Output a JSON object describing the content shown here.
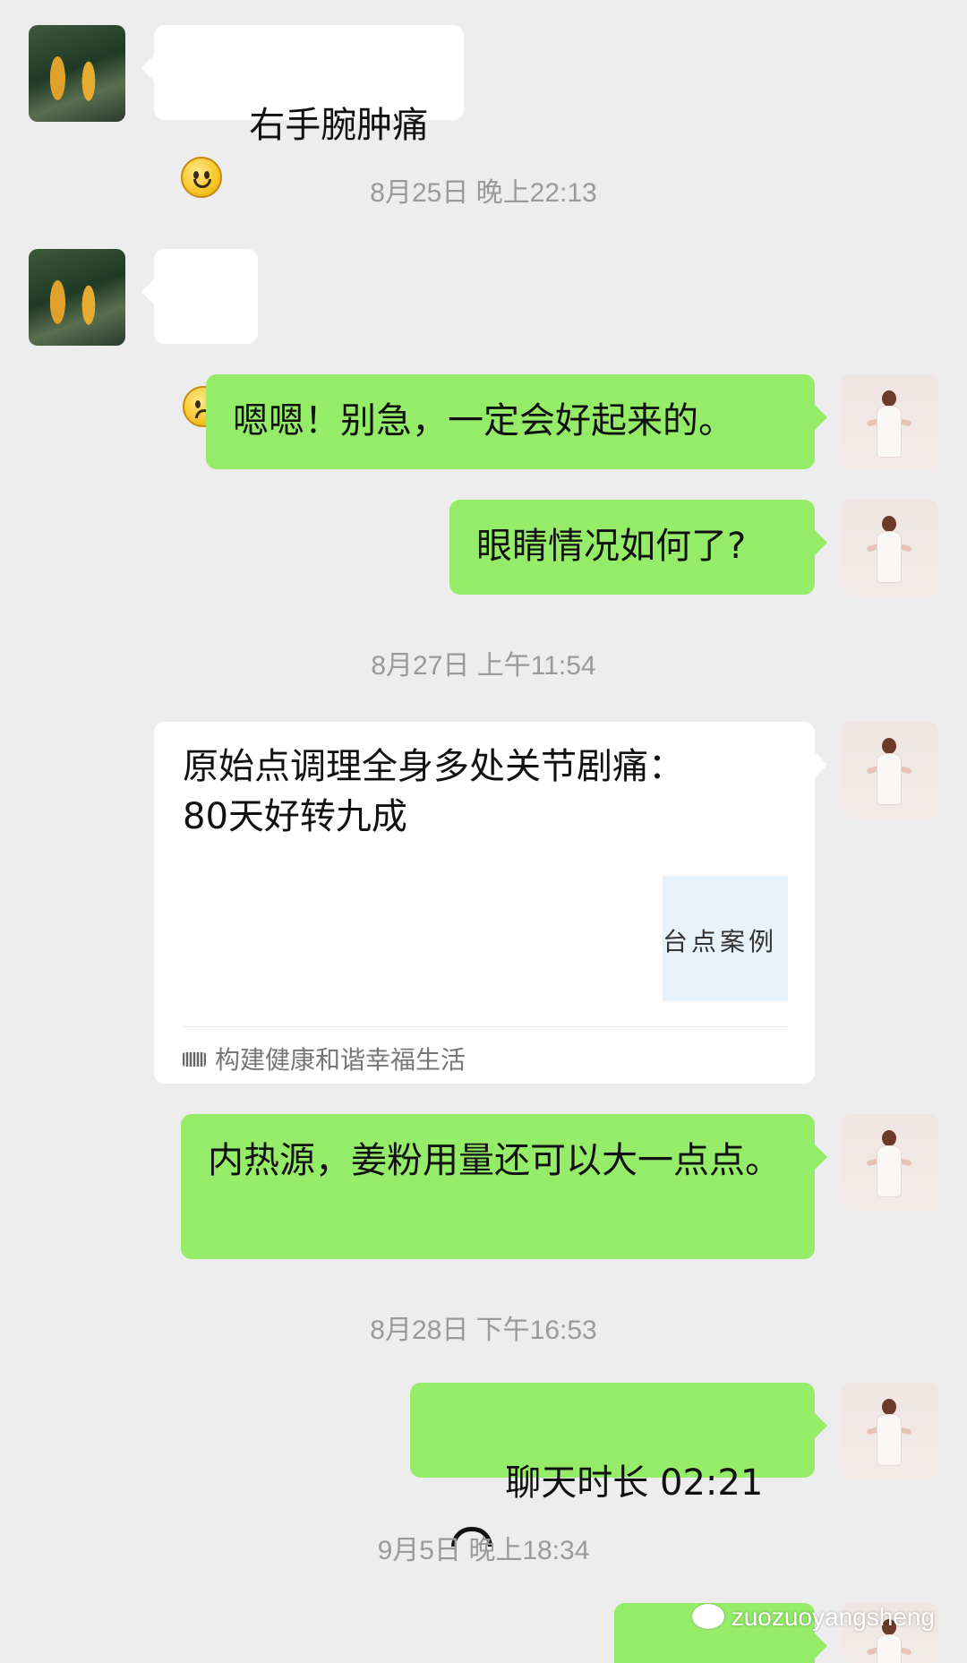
{
  "messages": {
    "m1": "右手腕肿痛",
    "m2": "",
    "m3": "嗯嗯！别急，一定会好起来的。",
    "m4": "眼睛情况如何了?",
    "m5_title": "原始点调理全身多处关节剧痛：80天好转九成",
    "m5_thumb": "台点案例",
    "m5_source": "构建健康和谐幸福生活",
    "m6": "内热源，姜粉用量还可以大一点点。",
    "m7": "聊天时长 02:21"
  },
  "timestamps": {
    "t1": "8月25日 晚上22:13",
    "t2": "8月27日 上午11:54",
    "t3": "8月28日 下午16:53",
    "t4": "9月5日 晚上18:34"
  },
  "watermark": "zuozuoyangsheng",
  "icons": {
    "smile": "smile-emoji",
    "sad": "sad-emoji",
    "call": "phone-hangup-icon",
    "wechat": "wechat-icon"
  },
  "colors": {
    "background": "#ededed",
    "bubble_green": "#95ec69",
    "bubble_white": "#ffffff",
    "timestamp": "#9a9a9a"
  }
}
